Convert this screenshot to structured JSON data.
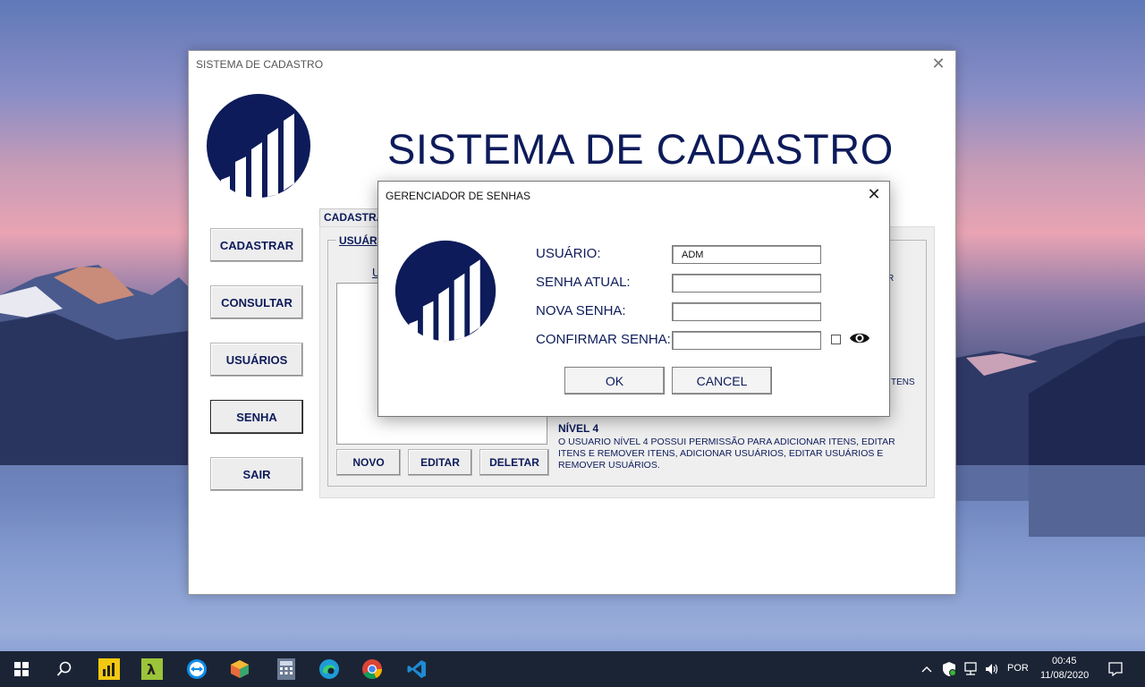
{
  "main_window": {
    "title": "SISTEMA DE CADASTRO",
    "heading": "SISTEMA DE CADASTRO",
    "close_icon": "close-icon",
    "nav": [
      {
        "label": "CADASTRAR"
      },
      {
        "label": "CONSULTAR"
      },
      {
        "label": "USUÁRIOS"
      },
      {
        "label": "SENHA"
      },
      {
        "label": "SAIR"
      }
    ],
    "tab_label": "CADASTRA",
    "group_label": "USUÁR",
    "list_header": "U",
    "buttons": {
      "new": "NOVO",
      "edit": "EDITAR",
      "delete": "DELETAR"
    },
    "fragments": {
      "r": "R",
      "itens": "TENS"
    },
    "level4_title": "NÍVEL 4",
    "level4_desc": "O USUARIO NÍVEL 4 POSSUI PERMISSÃO PARA ADICIONAR ITENS, EDITAR ITENS E REMOVER ITENS, ADICIONAR USUÁRIOS, EDITAR USUÁRIOS E REMOVER USUÁRIOS."
  },
  "dialog": {
    "title": "GERENCIADOR DE SENHAS",
    "labels": {
      "user": "USUÁRIO:",
      "current_password": "SENHA ATUAL:",
      "new_password": "NOVA SENHA:",
      "confirm_password": "CONFIRMAR SENHA:"
    },
    "values": {
      "user": "ADM",
      "current_password": "",
      "new_password": "",
      "confirm_password": ""
    },
    "ok": "OK",
    "cancel": "CANCEL",
    "show_password_checked": false
  },
  "taskbar": {
    "icons": [
      "windows-start-icon",
      "search-icon",
      "power-bi-icon",
      "lambda-app-icon",
      "teamviewer-icon",
      "box-app-icon",
      "calculator-icon",
      "edge-icon",
      "chrome-icon",
      "vscode-icon"
    ],
    "language": "POR",
    "time": "00:45",
    "date": "11/08/2020"
  },
  "colors": {
    "brand": "#0d1b5a",
    "taskbar": "#1b2435"
  }
}
